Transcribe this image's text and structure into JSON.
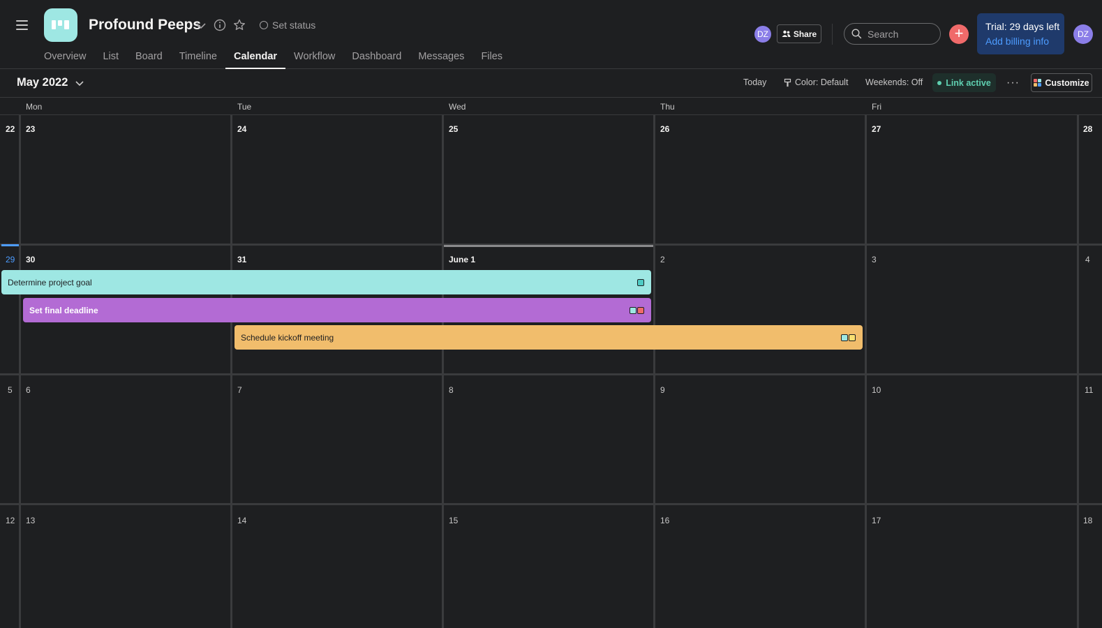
{
  "project": {
    "title": "Profound Peeps",
    "set_status": "Set status",
    "icon_color": "#9ee7e3"
  },
  "tabs": [
    {
      "label": "Overview",
      "active": false
    },
    {
      "label": "List",
      "active": false
    },
    {
      "label": "Board",
      "active": false
    },
    {
      "label": "Timeline",
      "active": false
    },
    {
      "label": "Calendar",
      "active": true
    },
    {
      "label": "Workflow",
      "active": false
    },
    {
      "label": "Dashboard",
      "active": false
    },
    {
      "label": "Messages",
      "active": false
    },
    {
      "label": "Files",
      "active": false
    }
  ],
  "header": {
    "member_avatar": "DZ",
    "share_label": "Share",
    "search_placeholder": "Search",
    "trial_line1": "Trial: 29 days left",
    "trial_line2": "Add billing info",
    "user_avatar": "DZ"
  },
  "toolbar": {
    "month": "May 2022",
    "today": "Today",
    "color": "Color: Default",
    "weekends": "Weekends: Off",
    "link": "Link active",
    "customize": "Customize"
  },
  "day_headers": [
    "Mon",
    "Tue",
    "Wed",
    "Thu",
    "Fri"
  ],
  "weeks": [
    {
      "sun": "22",
      "days": [
        "23",
        "24",
        "25",
        "26",
        "27"
      ],
      "sat": "28"
    },
    {
      "sun": "29",
      "days": [
        "30",
        "31",
        "June 1",
        "2",
        "3"
      ],
      "sat": "4"
    },
    {
      "sun": "5",
      "days": [
        "6",
        "7",
        "8",
        "9",
        "10"
      ],
      "sat": "11"
    },
    {
      "sun": "12",
      "days": [
        "13",
        "14",
        "15",
        "16",
        "17"
      ],
      "sat": "18"
    }
  ],
  "tasks": [
    {
      "name": "Determine project goal",
      "color": "#9ee7e3",
      "tags": [
        "#4ecbc4"
      ]
    },
    {
      "name": "Set final deadline",
      "color": "#b36bd4",
      "tags": [
        "#9ee7e3",
        "#f06a6a"
      ]
    },
    {
      "name": "Schedule kickoff meeting",
      "color": "#f1bd6c",
      "tags": [
        "#9ee7e3",
        "#f8df72"
      ]
    }
  ],
  "colors": {
    "background": "#1e1f21",
    "accent_blue": "#4d9cff",
    "add_button": "#f06a6a",
    "trial_bg": "#1f3a6b",
    "avatar": "#8b7ee8"
  }
}
